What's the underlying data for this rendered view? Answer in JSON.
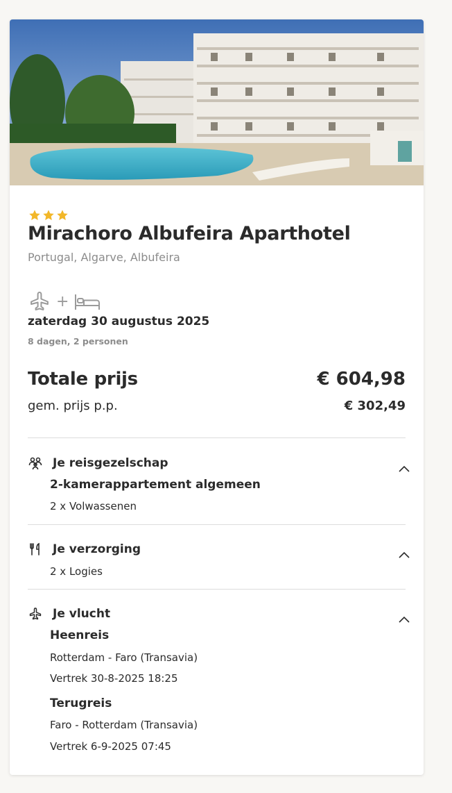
{
  "hotel": {
    "star_count": 3,
    "name": "Mirachoro Albufeira Aparthotel",
    "location": "Portugal,  Algarve,  Albufeira",
    "star_color": "#f2b729"
  },
  "trip": {
    "transport": "flight-plus-hotel",
    "plus": "+",
    "date": "zaterdag 30 augustus 2025",
    "duration": "8 dagen, 2 personen"
  },
  "price": {
    "total_label": "Totale prijs",
    "total_value": "€ 604,98",
    "pp_label": "gem. prijs p.p.",
    "pp_value": "€ 302,49"
  },
  "sections": {
    "travel_party": {
      "title": "Je reisgezelschap",
      "room": "2-kamerappartement algemeen",
      "guests": "2 x Volwassenen"
    },
    "board": {
      "title": "Je verzorging",
      "value": "2 x Logies"
    },
    "flight": {
      "title": "Je vlucht",
      "outbound_title": "Heenreis",
      "outbound_route": "Rotterdam - Faro (Transavia)",
      "outbound_departure": "Vertrek 30-8-2025 18:25",
      "return_title": "Terugreis",
      "return_route": "Faro - Rotterdam (Transavia)",
      "return_departure": "Vertrek 6-9-2025 07:45"
    }
  }
}
